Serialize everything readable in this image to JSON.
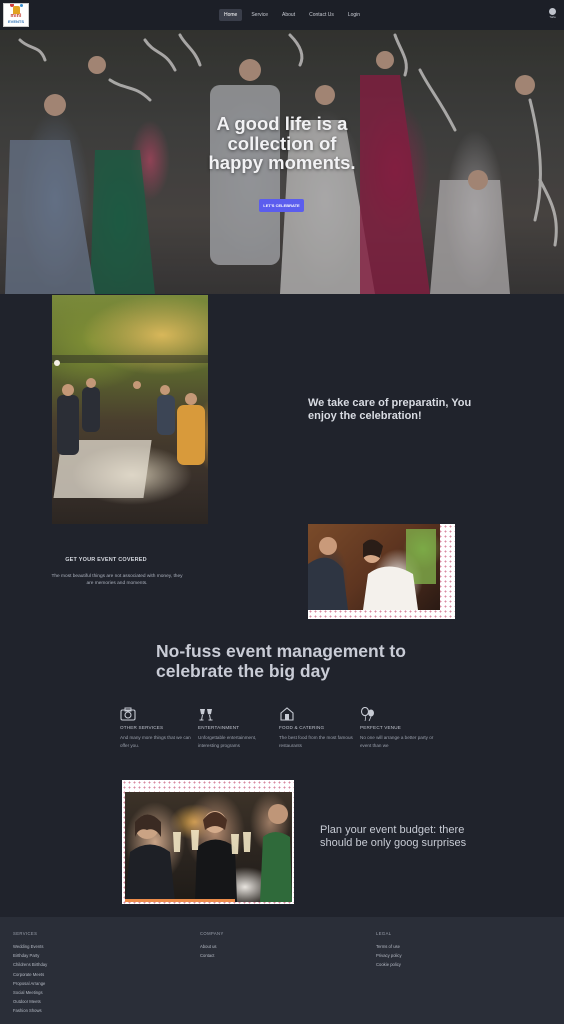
{
  "nav": {
    "logo": {
      "line1": "mini",
      "line2": "EVENTS"
    },
    "items": [
      {
        "label": "Home",
        "active": true
      },
      {
        "label": "Service",
        "active": false
      },
      {
        "label": "About",
        "active": false
      },
      {
        "label": "Contact Us",
        "active": false
      },
      {
        "label": "Login",
        "active": false
      }
    ],
    "user_label": "Taifa"
  },
  "hero": {
    "headline": "A good life is a collection of happy moments.",
    "cta": "LET'S CELEBRATE",
    "cta_color": "#5b5dee"
  },
  "prep": {
    "tagline": "We take care of preparatin, You enjoy the celebration!"
  },
  "cover": {
    "title": "GET YOUR EVENT COVERED",
    "text": "The most beautiful things are not associated with money, they are memories and moments."
  },
  "management": {
    "headline": "No-fuss event management to celebrate the big day"
  },
  "features": [
    {
      "icon": "camera-icon",
      "title": "OTHER SERVICES",
      "desc": "And many more things that we can offer you."
    },
    {
      "icon": "champagne-glasses-icon",
      "title": "ENTERTAINMENT",
      "desc": "Unforgettable entertainment, interesting programs"
    },
    {
      "icon": "restaurant-icon",
      "title": "FOOD & CATERING",
      "desc": "The best food from the most famous restaurants"
    },
    {
      "icon": "balloons-icon",
      "title": "PERFECT VENUE",
      "desc": "No one will arrange a better party or event than we"
    }
  ],
  "budget": {
    "text": "Plan your event budget: there should be only goog surprises"
  },
  "footer": {
    "services": {
      "heading": "SERVICES",
      "links": [
        "Wedding Events",
        "Birthday Party",
        "Childrens Birthday",
        "Corporate Meets",
        "Proposal Arrange",
        "Social Meetings",
        "Outdoor Meets",
        "Fashion Shows"
      ]
    },
    "company": {
      "heading": "COMPANY",
      "links": [
        "About us",
        "Contact"
      ]
    },
    "legal": {
      "heading": "LEGAL",
      "links": [
        "Terms of use",
        "Privacy policy",
        "Cookie policy"
      ]
    }
  }
}
